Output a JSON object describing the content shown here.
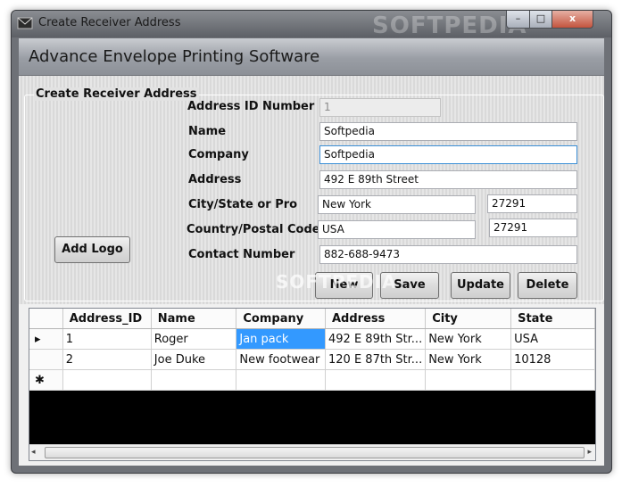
{
  "window": {
    "title": "Create Receiver Address",
    "watermark": "SOFTPEDIA",
    "caption": {
      "minimize": "–",
      "maximize": "□",
      "close": "x"
    }
  },
  "banner": {
    "title": "Advance Envelope Printing Software"
  },
  "form": {
    "group_title": "Create Receiver Address",
    "add_logo": "Add Logo",
    "labels": {
      "address_id": "Address ID Number",
      "name": "Name",
      "company": "Company",
      "address": "Address",
      "city_state": "City/State or Pro",
      "country_postal": "Country/Postal Code",
      "contact": "Contact Number"
    },
    "values": {
      "address_id": "1",
      "name": "Softpedia",
      "company": "Softpedia",
      "address": "492 E 89th Street",
      "city": "New York",
      "state": "27291",
      "country": "USA",
      "postal": "27291",
      "contact": "882-688-9473"
    },
    "buttons": {
      "new": "New",
      "save": "Save",
      "update": "Update",
      "delete": "Delete"
    },
    "watermark": "SOFTPEDIA"
  },
  "grid": {
    "columns": [
      "Address_ID",
      "Name",
      "Company",
      "Address",
      "City",
      "State"
    ],
    "rows": [
      {
        "indicator": "▸",
        "cells": [
          "1",
          "Roger",
          "Jan pack",
          "492 E 89th Str...",
          "New York",
          "USA"
        ]
      },
      {
        "indicator": "",
        "cells": [
          "2",
          "Joe Duke",
          "New footwear",
          "120 E 87th Str...",
          "New York",
          "10128"
        ]
      }
    ],
    "new_row_indicator": "✱",
    "scroll": {
      "left": "◂",
      "right": "▸"
    }
  },
  "colors": {
    "selection": "#3399ff",
    "grid_background": "#000000"
  }
}
